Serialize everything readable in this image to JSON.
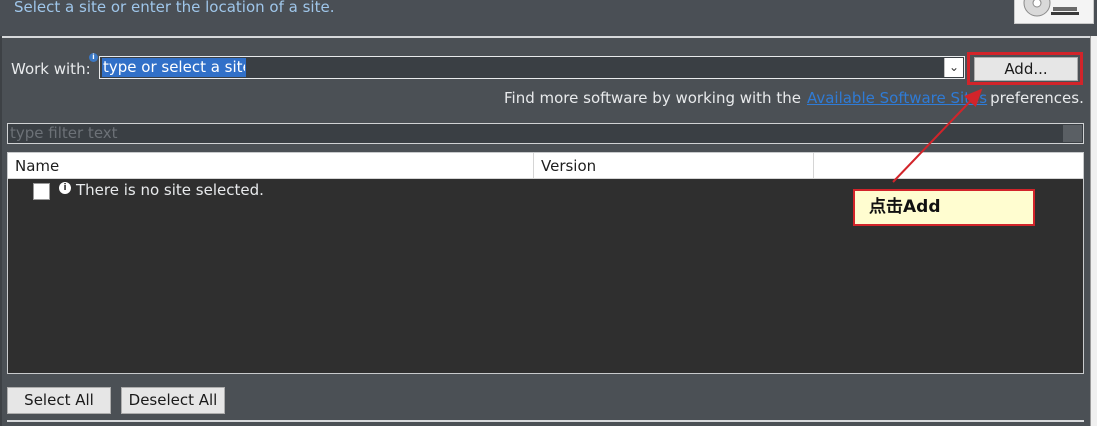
{
  "header": {
    "subtitle": "Select a site or enter the location of a site.",
    "logo_icon": "install-wizard-logo"
  },
  "work_with": {
    "label": "Work with:",
    "info_icon": "info-icon",
    "input_value": "type or select a site",
    "dropdown_icon": "chevron-down-icon",
    "add_button": "Add..."
  },
  "find_more": {
    "prefix": "Find more software by working with the",
    "link": "Available Software Sites",
    "suffix": "preferences."
  },
  "filter": {
    "placeholder": "type filter text"
  },
  "table": {
    "columns": [
      "Name",
      "Version",
      ""
    ],
    "rows": [
      {
        "checked": false,
        "icon": "info-icon",
        "text": "There is no site selected."
      }
    ]
  },
  "annotation": {
    "text": "点击Add",
    "border_color": "#d2242a",
    "fill_color": "#fffdd0"
  },
  "buttons": {
    "select_all": "Select All",
    "deselect_all": "Deselect All"
  }
}
